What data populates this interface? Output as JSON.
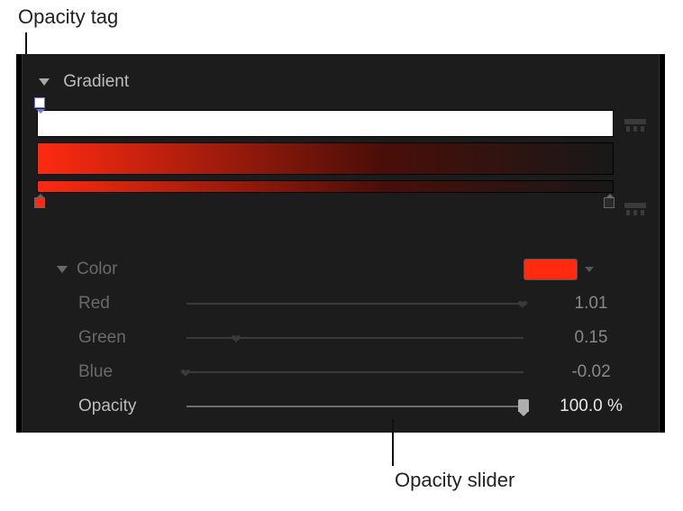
{
  "callouts": {
    "opacity_tag": "Opacity tag",
    "opacity_slider": "Opacity slider"
  },
  "section": "Gradient",
  "color_section": {
    "title": "Color",
    "swatch_color": "#ff2a10",
    "channels": {
      "red": {
        "label": "Red",
        "value": "1.01",
        "pos": 100
      },
      "green": {
        "label": "Green",
        "value": "0.15",
        "pos": 15
      },
      "blue": {
        "label": "Blue",
        "value": "-0.02",
        "pos": 0
      },
      "opacity": {
        "label": "Opacity",
        "value": "100.0 %",
        "pos": 100
      }
    }
  },
  "gradient": {
    "stops": [
      {
        "color": "#ff2a10",
        "position": 0
      },
      {
        "color": "#1a1a1a",
        "position": 100
      }
    ],
    "opacity_stops": [
      {
        "opacity": 100,
        "position": 0
      }
    ]
  }
}
